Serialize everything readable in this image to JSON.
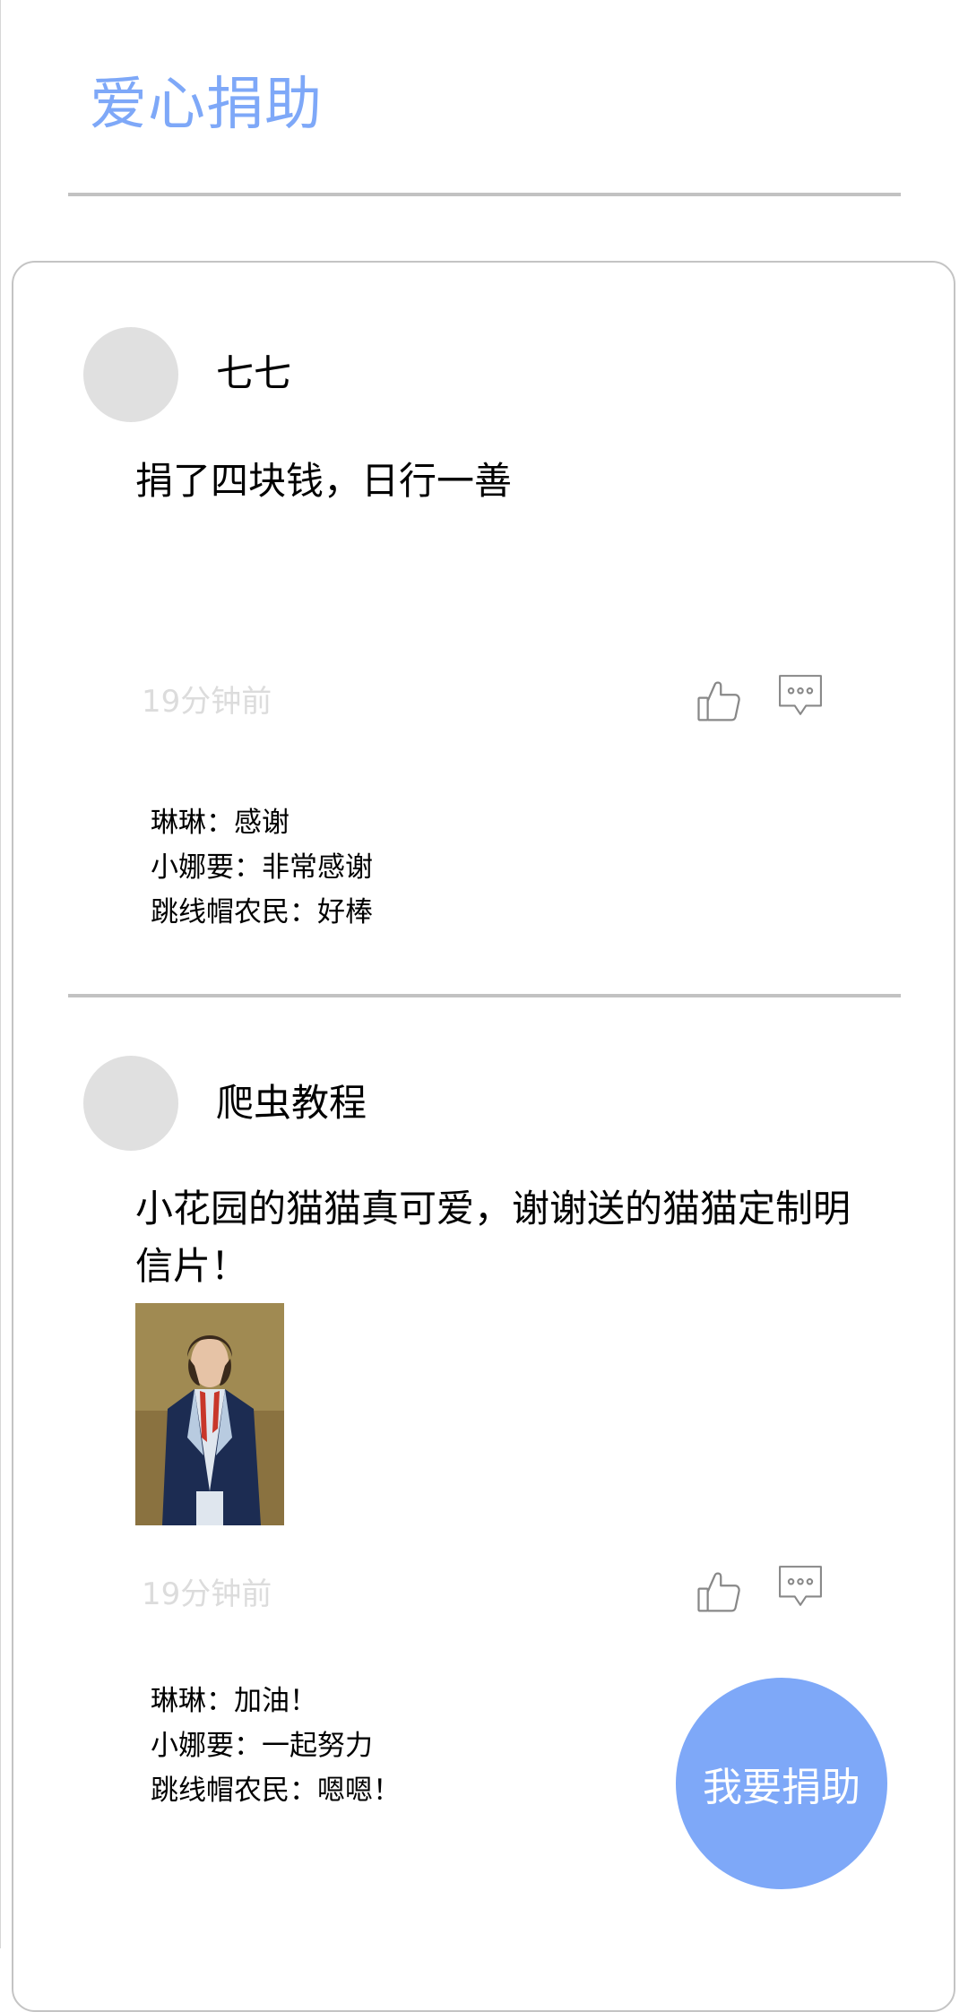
{
  "page": {
    "title": "爱心捐助"
  },
  "posts": [
    {
      "username": "七七",
      "text": "捐了四块钱，日行一善",
      "time": "19分钟前",
      "icons": {
        "like": "thumbs-up-icon",
        "comment": "comment-bubble-icon"
      },
      "comments": [
        {
          "author": "琳琳",
          "separator": "：",
          "content": "感谢"
        },
        {
          "author": "小娜要",
          "separator": "：",
          "content": "非常感谢"
        },
        {
          "author": "跳线帽农民",
          "separator": "：",
          "content": "好棒"
        }
      ]
    },
    {
      "username": "爬虫教程",
      "text": "小花园的猫猫真可爱，谢谢送的猫猫定制明信片！",
      "has_image": true,
      "time": "19分钟前",
      "icons": {
        "like": "thumbs-up-icon",
        "comment": "comment-bubble-icon"
      },
      "comments": [
        {
          "author": "琳琳",
          "separator": "：",
          "content": "加油！"
        },
        {
          "author": "小娜要",
          "separator": "：",
          "content": "一起努力"
        },
        {
          "author": "跳线帽农民",
          "separator": "：",
          "content": "嗯嗯！"
        }
      ]
    }
  ],
  "fab": {
    "label": "我要捐助"
  },
  "colors": {
    "accent": "#7ea8f8",
    "divider": "#c2c2c2",
    "avatar": "#e0e0e0",
    "muted_text": "#dcdcdc"
  }
}
